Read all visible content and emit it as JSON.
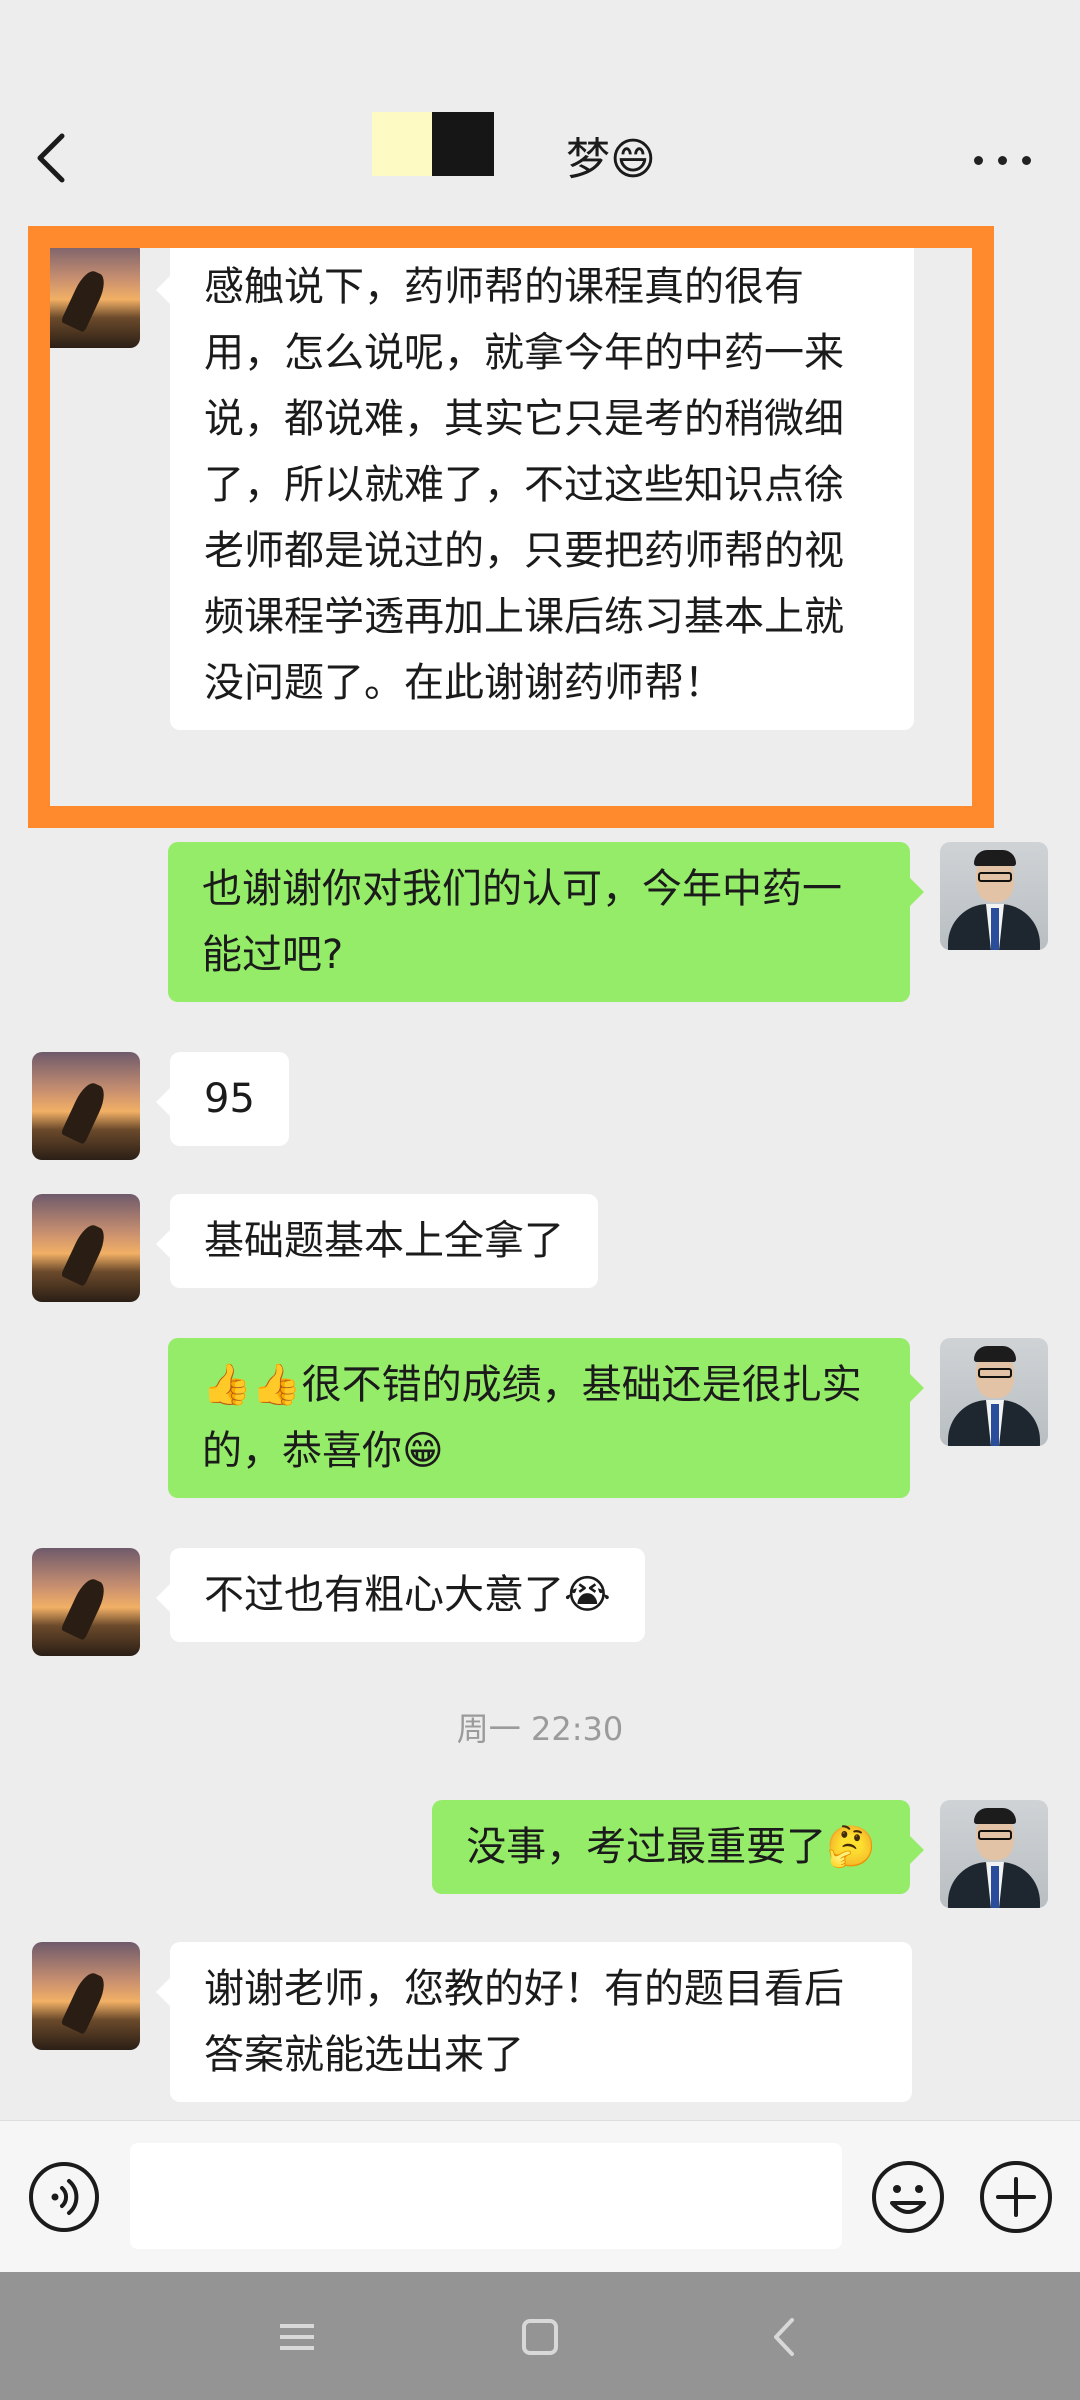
{
  "header": {
    "title": "梦😄"
  },
  "messages": [
    {
      "id": "m1",
      "from": "them",
      "text": "感触说下，药师帮的课程真的很有用，怎么说呢，就拿今年的中药一来说，都说难，其实它只是考的稍微细了，所以就难了，不过这些知识点徐老师都是说过的，只要把药师帮的视频课程学透再加上课后练习基本上就没问题了。在此谢谢药师帮！"
    },
    {
      "id": "m2",
      "from": "me",
      "text": "也谢谢你对我们的认可，今年中药一能过吧?"
    },
    {
      "id": "m3",
      "from": "them",
      "text": "95"
    },
    {
      "id": "m4",
      "from": "them",
      "text": "基础题基本上全拿了"
    },
    {
      "id": "m5",
      "from": "me",
      "text": "👍👍很不错的成绩，基础还是很扎实的，恭喜你😁"
    },
    {
      "id": "m6",
      "from": "them",
      "text": "不过也有粗心大意了😭"
    },
    {
      "id": "m7",
      "from": "me",
      "text": "没事，考过最重要了🤔"
    },
    {
      "id": "m8",
      "from": "them",
      "text": "谢谢老师，您教的好！有的题目看后答案就能选出来了"
    }
  ],
  "timestamp": "周一 22:30",
  "input": {
    "value": ""
  },
  "colors": {
    "background": "#ededed",
    "bubble_me": "#95ec69",
    "bubble_them": "#ffffff",
    "highlight": "#ff8a2e",
    "nav_bar": "#949494"
  },
  "icons": {
    "back": "chevron-left-icon",
    "more": "more-dots-icon",
    "voice": "voice-icon",
    "emoji": "emoji-icon",
    "plus": "plus-icon",
    "nav_menu": "menu-icon",
    "nav_home": "home-square-icon",
    "nav_back": "nav-back-icon"
  }
}
